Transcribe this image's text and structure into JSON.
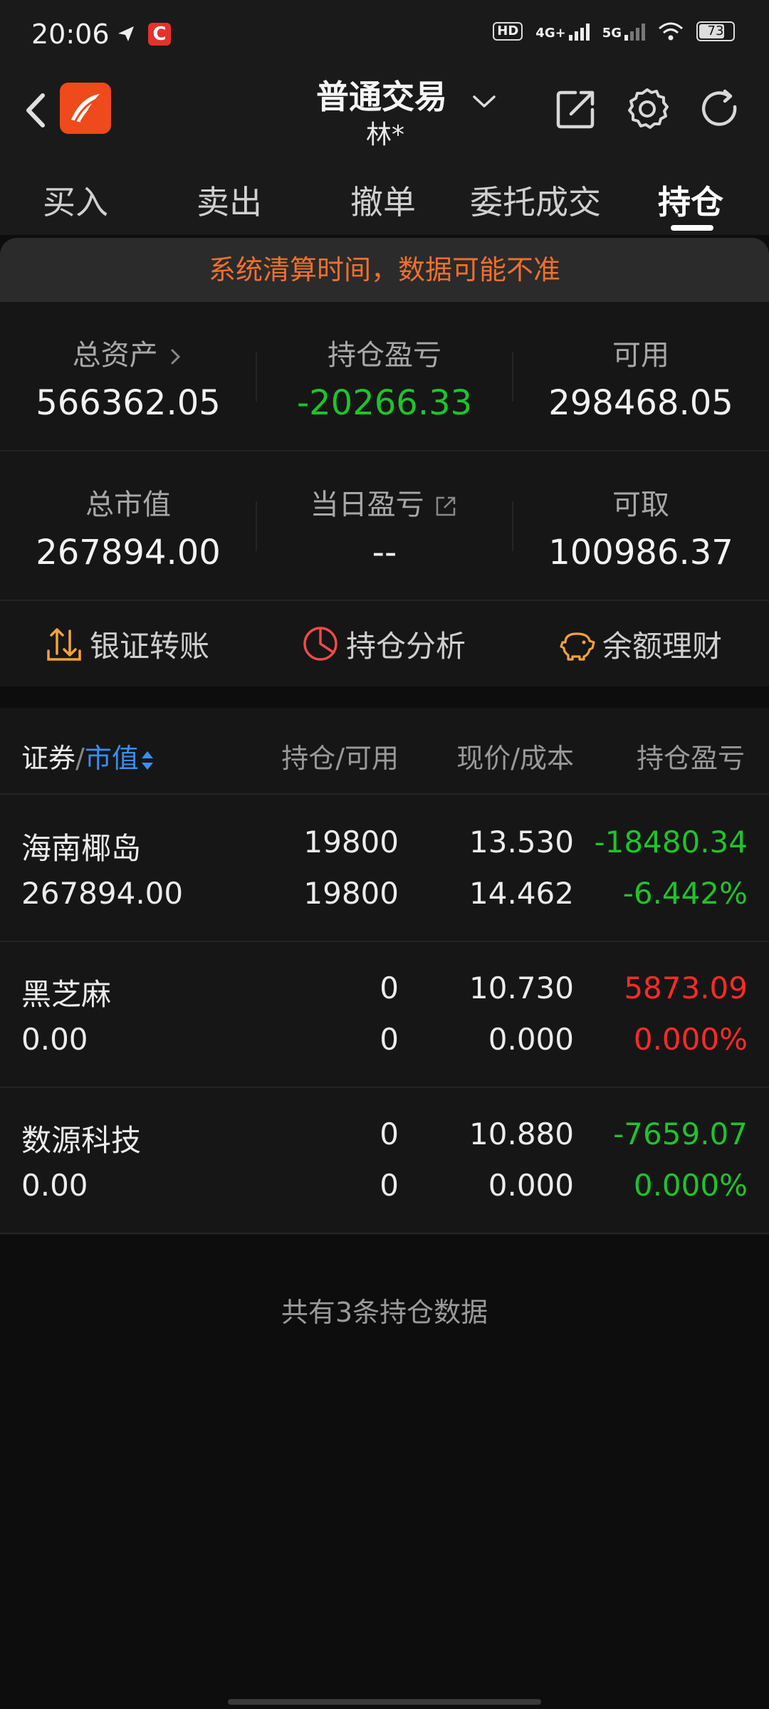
{
  "status_bar": {
    "time": "20:06",
    "hd_label": "HD",
    "net1": "4G+",
    "net2": "5G",
    "battery": "73"
  },
  "header": {
    "title": "普通交易",
    "subtitle": "林*"
  },
  "tabs": [
    {
      "label": "买入"
    },
    {
      "label": "卖出"
    },
    {
      "label": "撤单"
    },
    {
      "label": "委托成交"
    },
    {
      "label": "持仓"
    }
  ],
  "notice": "系统清算时间，数据可能不准",
  "summary": {
    "total_assets_label": "总资产",
    "total_assets": "566362.05",
    "position_pl_label": "持仓盈亏",
    "position_pl": "-20266.33",
    "available_label": "可用",
    "available": "298468.05",
    "market_value_label": "总市值",
    "market_value": "267894.00",
    "daily_pl_label": "当日盈亏",
    "daily_pl": "--",
    "withdrawable_label": "可取",
    "withdrawable": "100986.37"
  },
  "actions": [
    {
      "label": "银证转账"
    },
    {
      "label": "持仓分析"
    },
    {
      "label": "余额理财"
    }
  ],
  "table": {
    "headers": {
      "security": "证券",
      "sep": "/",
      "market_value": "市值",
      "qty": "持仓/可用",
      "price": "现价/成本",
      "pl": "持仓盈亏"
    },
    "rows": [
      {
        "name": "海南椰岛",
        "value": "267894.00",
        "hold": "19800",
        "avail": "19800",
        "price": "13.530",
        "cost": "14.462",
        "pl": "-18480.34",
        "pl_pct": "-6.442%"
      },
      {
        "name": "黑芝麻",
        "value": "0.00",
        "hold": "0",
        "avail": "0",
        "price": "10.730",
        "cost": "0.000",
        "pl": "5873.09",
        "pl_pct": "0.000%"
      },
      {
        "name": "数源科技",
        "value": "0.00",
        "hold": "0",
        "avail": "0",
        "price": "10.880",
        "cost": "0.000",
        "pl": "-7659.07",
        "pl_pct": "0.000%"
      }
    ]
  },
  "footer_note": "共有3条持仓数据",
  "colors": {
    "green": "#1ec42a",
    "red": "#ff2a2a",
    "blue": "#3a8ef0",
    "notice": "#f0702e",
    "logo": "#ee4a1c"
  }
}
